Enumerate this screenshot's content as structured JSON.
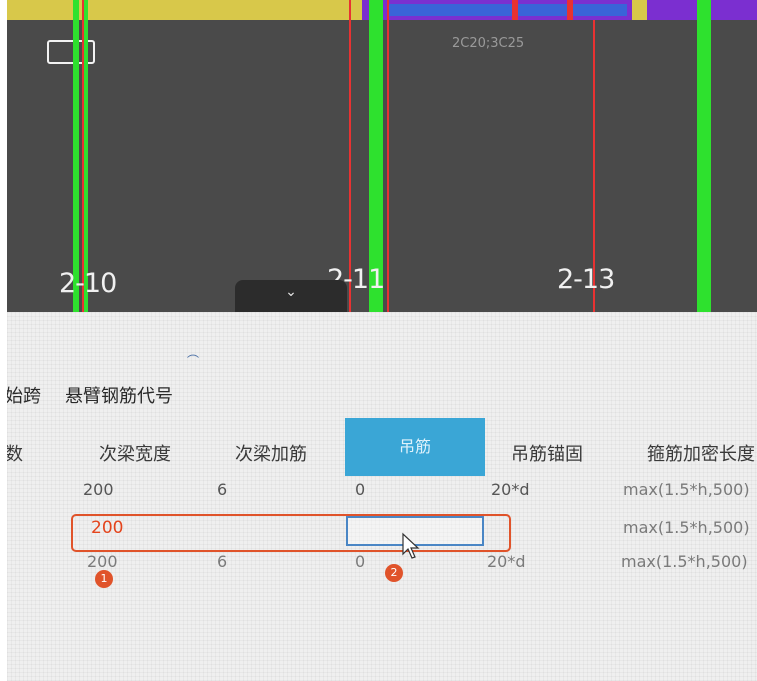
{
  "colors": {
    "canvas_bg": "#4a4a4a",
    "column_line": "#2ee12e",
    "axis_line": "#e83232",
    "active_header_bg": "#3aa6d6",
    "highlight": "#e0532a",
    "edit_border": "#4a86c5"
  },
  "cad": {
    "rebar_annotation": "2C20;3C25",
    "axis_labels": [
      "2-10",
      "2-11",
      "2-13"
    ],
    "collapse_icon": "chevron-down-icon",
    "collapse_glyph": "⌄"
  },
  "tabs": [
    "始跨",
    "悬臂钢筋代号"
  ],
  "table": {
    "columns": [
      "数",
      "次梁宽度",
      "次梁加筋",
      "吊筋",
      "吊筋锚固",
      "箍筋加密长度"
    ],
    "rows": [
      [
        "200",
        "6",
        "0",
        "",
        "20*d",
        "max(1.5*h,500)"
      ],
      [
        "200",
        "",
        "",
        "",
        "",
        "max(1.5*h,500)"
      ],
      [
        "200",
        "6",
        "0",
        "",
        "20*d",
        "max(1.5*h,500)"
      ]
    ]
  },
  "annotations": {
    "marker_1": "1",
    "marker_2": "2"
  }
}
